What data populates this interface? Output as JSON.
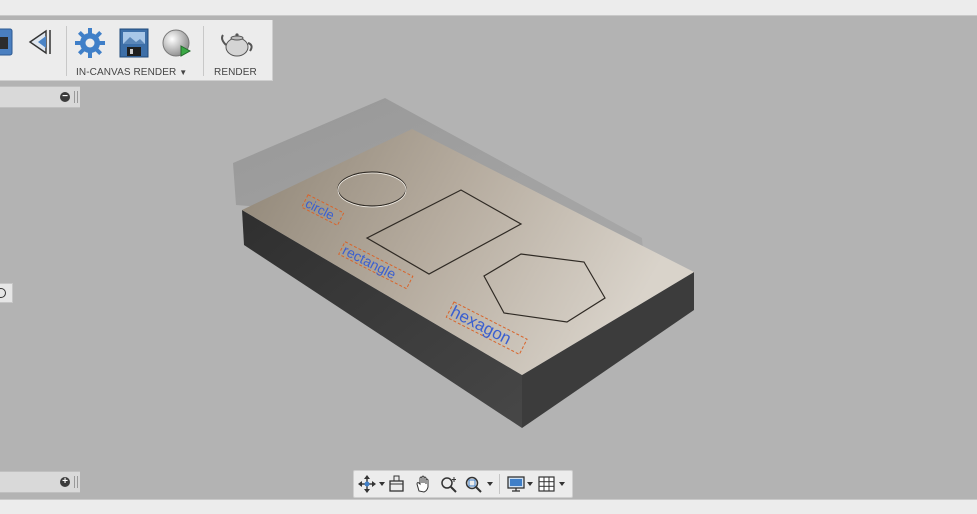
{
  "toolbar": {
    "in_canvas_render_label": "IN-CANVAS RENDER",
    "render_label": "RENDER"
  },
  "model": {
    "labels": [
      "circle",
      "rectangle",
      "hexagon"
    ],
    "label_color": "#3a5fd0",
    "label_box_color": "#d9642a"
  },
  "colors": {
    "accent": "#2b7bd6",
    "background": "#b3b3b3",
    "plate_top": "#b8aea2",
    "plate_side": "#3a3a3a"
  },
  "navbar": {
    "icons": [
      "orbit-icon",
      "look-at-icon",
      "pan-icon",
      "zoom-icon",
      "fit-icon",
      "display-settings-icon",
      "grid-settings-icon"
    ]
  }
}
